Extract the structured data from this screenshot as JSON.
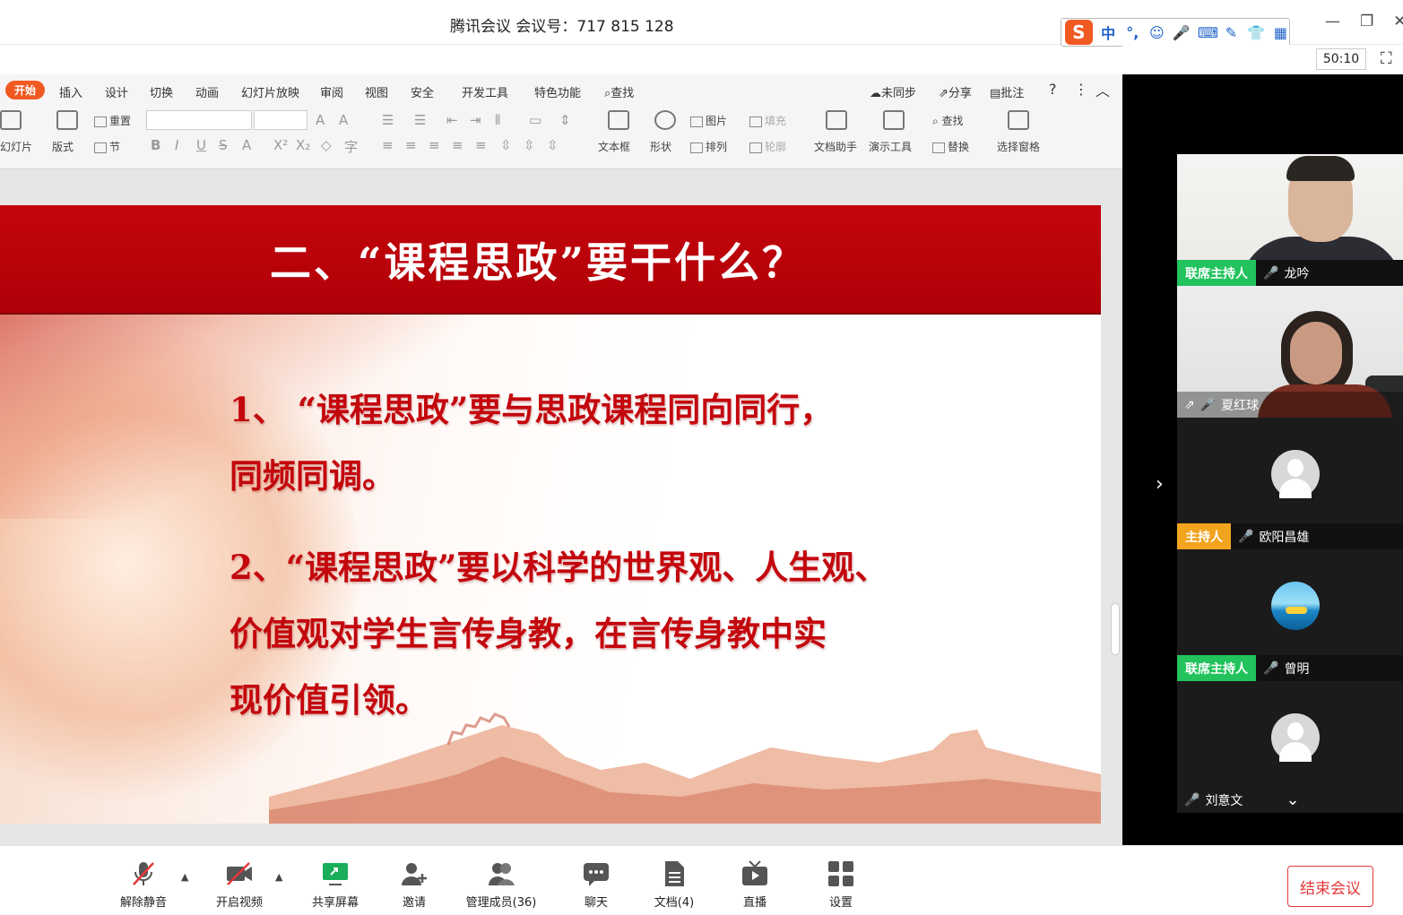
{
  "window": {
    "title": "腾讯会议 会议号：717 815 128",
    "timer": "50:10",
    "minimize_glyph": "—",
    "restore_glyph": "❐",
    "close_glyph": "✕",
    "fullscreen_glyph": "⛶"
  },
  "ime": {
    "logo": "S",
    "items": [
      "中",
      "°,",
      "☺",
      "🎤",
      "⌨",
      "✎",
      "👕",
      "▦"
    ]
  },
  "ppt": {
    "menu": {
      "start": "开始",
      "items": [
        "插入",
        "设计",
        "切换",
        "动画",
        "幻灯片放映",
        "审阅",
        "视图",
        "安全",
        "开发工具",
        "特色功能",
        "查找"
      ],
      "right": [
        "未同步",
        "分享",
        "批注",
        "?",
        "⋮",
        "︿"
      ]
    },
    "toolbar": {
      "new_slide": "幻灯片",
      "layout": "版式",
      "reset": "重置",
      "section": "节",
      "textbox": "文本框",
      "shape": "形状",
      "picture": "图片",
      "fill": "填充",
      "arrange": "排列",
      "outline": "轮廓",
      "doc_assist": "文档助手",
      "present_tools": "演示工具",
      "find": "查找",
      "replace": "替换",
      "select_pane": "选择窗格"
    },
    "slide": {
      "title": "二、“课程思政”要干什么？",
      "lines": [
        "1、 “课程思政”要与思政课程同向同行，",
        "同频同调。",
        "2、“课程思政”要以科学的世界观、人生观、",
        "价值观对学生言传身教，在言传身教中实",
        "现价值引领。"
      ]
    }
  },
  "participants": [
    {
      "role": "联席主持人",
      "name": "龙吟",
      "mic": "on",
      "role_color": "#22c35d"
    },
    {
      "role": "",
      "name": "夏红球",
      "mic": "on",
      "sharing": true
    },
    {
      "role": "主持人",
      "name": "欧阳昌雄",
      "mic": "muted",
      "role_color": "#f2a41f"
    },
    {
      "role": "联席主持人",
      "name": "曾明",
      "mic": "muted",
      "role_color": "#22c35d"
    },
    {
      "role": "",
      "name": "刘意文",
      "mic": "muted"
    }
  ],
  "panel": {
    "expand_glyph": "›",
    "collapse_glyph": "⌄"
  },
  "bottom_bar": {
    "unmute": "解除静音",
    "start_video": "开启视频",
    "share_screen": "共享屏幕",
    "invite": "邀请",
    "manage_members": "管理成员(36)",
    "chat": "聊天",
    "docs": "文档(4)",
    "live": "直播",
    "settings": "设置",
    "end_meeting": "结束会议",
    "caret": "▲"
  },
  "colors": {
    "accent": "#f05a22",
    "slide_red": "#c3070d",
    "end_red": "#e5383b",
    "share_green": "#1aad5a"
  }
}
